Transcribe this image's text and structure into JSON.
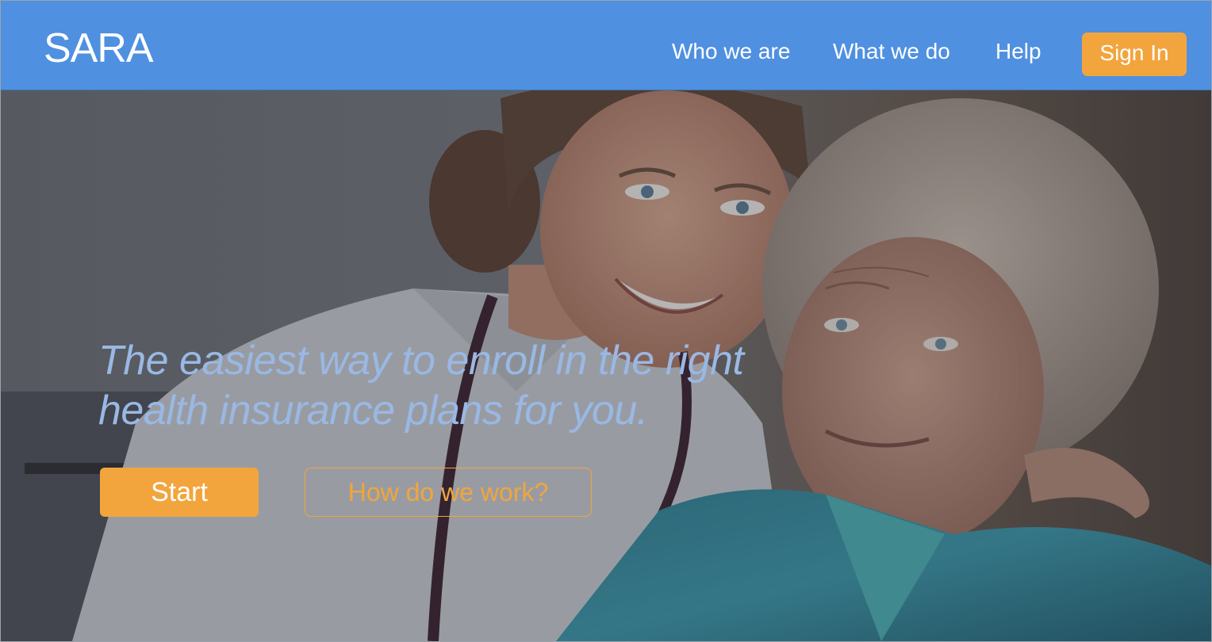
{
  "navbar": {
    "logo": "SARA",
    "links": [
      "Who we are",
      "What we do",
      "Help"
    ],
    "sign_in": "Sign In"
  },
  "hero": {
    "tagline_line1": "The easiest way to enroll in the right",
    "tagline_line2": "health insurance plans for you.",
    "start_label": "Start",
    "how_label": "How do we work?",
    "image_subject": "young nurse with stethoscope hugging smiling elderly woman"
  },
  "colors": {
    "nav_bg": "#4f90e0",
    "accent": "#f2a53c",
    "tagline": "#9ab8e4",
    "white": "#ffffff"
  }
}
